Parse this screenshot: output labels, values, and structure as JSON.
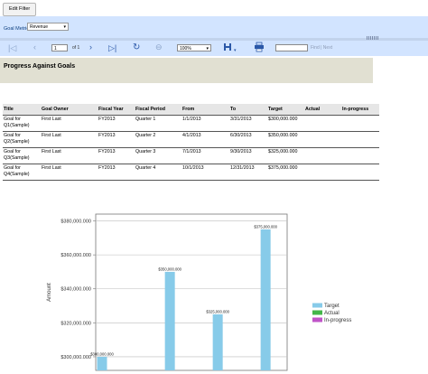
{
  "filter_button": "Edit Filter",
  "parameters": {
    "label": "Goal Metric",
    "value": "Revenue"
  },
  "toolbar": {
    "page": "1",
    "of_label": "of 1",
    "zoom": "100%",
    "find_links": "Find | Next",
    "icons": [
      "first-page-icon",
      "prev-page-icon",
      "next-page-icon",
      "refresh-icon",
      "back-icon",
      "save-icon",
      "print-icon"
    ]
  },
  "report": {
    "title": "Progress Against Goals",
    "columns": [
      "Title",
      "Goal Owner",
      "Fiscal Year",
      "Fiscal Period",
      "From",
      "To",
      "Target",
      "Actual",
      "In-progress"
    ],
    "rows": [
      {
        "title_l1": "Goal for",
        "title_l2": "Q1(Sample)",
        "owner": "First Last",
        "year": "FY2013",
        "period": "Quarter 1",
        "from": "1/1/2013",
        "to": "3/31/2013",
        "target": "$300,000.000",
        "actual": "",
        "inprogress": ""
      },
      {
        "title_l1": "Goal for",
        "title_l2": "Q2(Sample)",
        "owner": "First Last",
        "year": "FY2013",
        "period": "Quarter 2",
        "from": "4/1/2013",
        "to": "6/30/2013",
        "target": "$350,000.000",
        "actual": "",
        "inprogress": ""
      },
      {
        "title_l1": "Goal for",
        "title_l2": "Q3(Sample)",
        "owner": "First Last",
        "year": "FY2013",
        "period": "Quarter 3",
        "from": "7/1/2013",
        "to": "9/30/2013",
        "target": "$325,000.000",
        "actual": "",
        "inprogress": ""
      },
      {
        "title_l1": "Goal for",
        "title_l2": "Q4(Sample)",
        "owner": "First Last",
        "year": "FY2013",
        "period": "Quarter 4",
        "from": "10/1/2013",
        "to": "12/31/2013",
        "target": "$375,000.000",
        "actual": "",
        "inprogress": ""
      }
    ]
  },
  "chart_data": {
    "type": "bar",
    "categories": [
      "Q1",
      "Q2",
      "Q3",
      "Q4"
    ],
    "ylabel": "Amount",
    "ylim": [
      292000,
      384000
    ],
    "ticks": [
      300000,
      320000,
      340000,
      360000,
      380000
    ],
    "tick_labels": [
      "$300,000.000",
      "$320,000.000",
      "$340,000.000",
      "$360,000.000",
      "$380,000.000"
    ],
    "series": [
      {
        "name": "Target",
        "color": "#87cbe9",
        "values": [
          300000,
          350000,
          325000,
          375000
        ],
        "labels": [
          "$300,000.000",
          "$350,000.000",
          "$325,000.000",
          "$375,000.000"
        ]
      },
      {
        "name": "Actual",
        "color": "#43b649",
        "values": []
      },
      {
        "name": "In-progress",
        "color": "#c054c8",
        "values": []
      }
    ],
    "legend_position": "right"
  }
}
